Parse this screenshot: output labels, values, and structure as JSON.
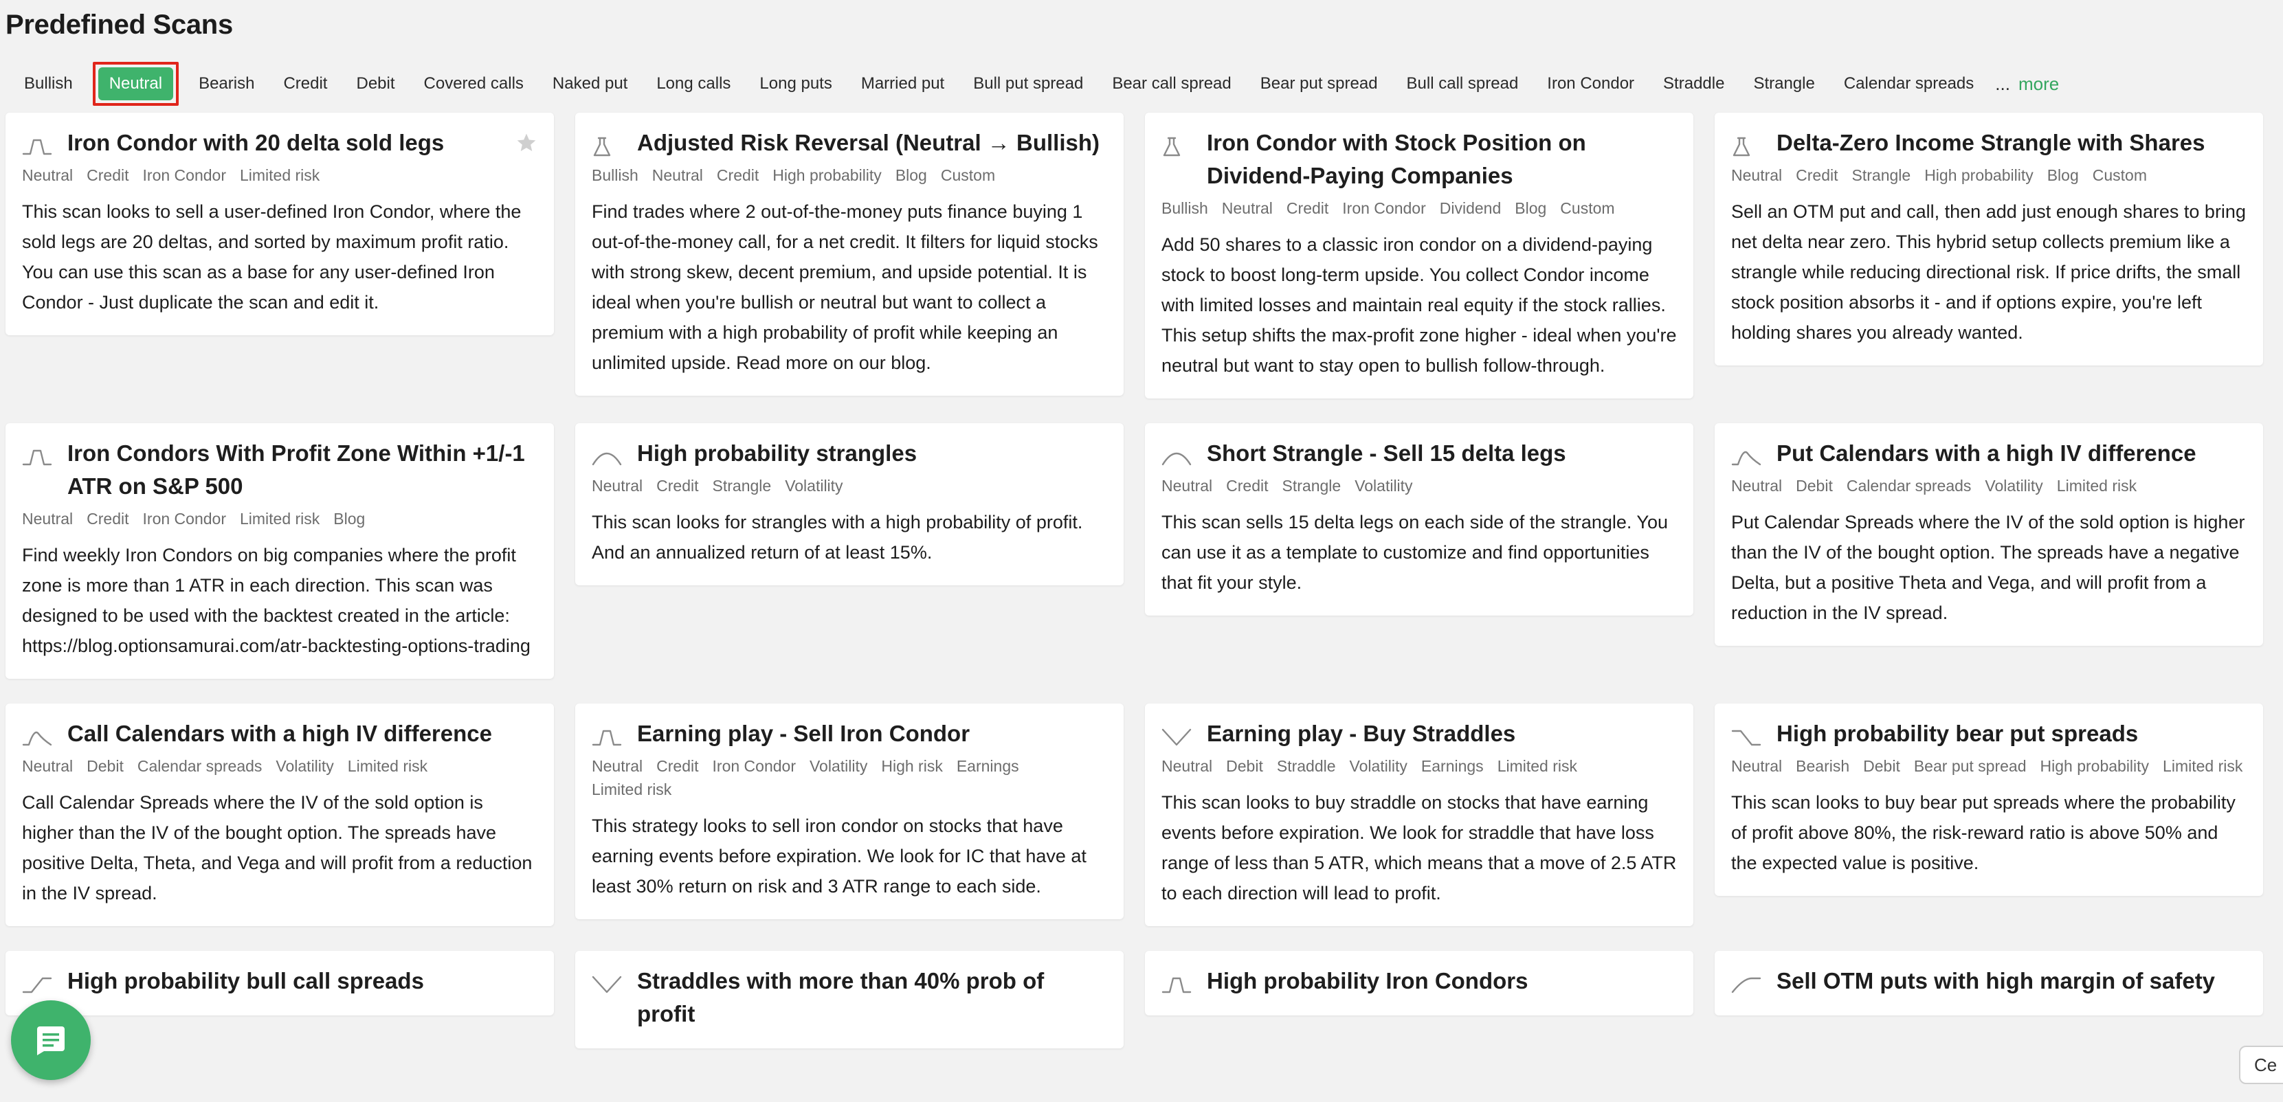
{
  "page": {
    "title": "Predefined Scans"
  },
  "filters": {
    "chips": [
      {
        "label": "Bullish"
      },
      {
        "label": "Neutral",
        "active": true
      },
      {
        "label": "Bearish"
      },
      {
        "label": "Credit"
      },
      {
        "label": "Debit"
      },
      {
        "label": "Covered calls"
      },
      {
        "label": "Naked put"
      },
      {
        "label": "Long calls"
      },
      {
        "label": "Long puts"
      },
      {
        "label": "Married put"
      },
      {
        "label": "Bull put spread"
      },
      {
        "label": "Bear call spread"
      },
      {
        "label": "Bear put spread"
      },
      {
        "label": "Bull call spread"
      },
      {
        "label": "Iron Condor"
      },
      {
        "label": "Straddle"
      },
      {
        "label": "Strangle"
      },
      {
        "label": "Calendar spreads"
      }
    ],
    "ellipsis": "...",
    "more_label": "more",
    "active_color": "#3fb36c",
    "highlight_color": "#e0251b"
  },
  "cards": [
    {
      "icon": "iron-condor-icon",
      "title": "Iron Condor with 20 delta sold legs",
      "starred": true,
      "tags": [
        "Neutral",
        "Credit",
        "Iron Condor",
        "Limited risk"
      ],
      "description": "This scan looks to sell a user-defined Iron Condor, where the sold legs are 20 deltas, and sorted by maximum profit ratio. You can use this scan as a base for any user-defined Iron Condor - Just duplicate the scan and edit it."
    },
    {
      "icon": "flask-icon",
      "title": "Adjusted Risk Reversal (Neutral → Bullish)",
      "tags": [
        "Bullish",
        "Neutral",
        "Credit",
        "High probability",
        "Blog",
        "Custom"
      ],
      "description": "Find trades where 2 out-of-the-money puts finance buying 1 out-of-the-money call, for a net credit. It filters for liquid stocks with strong skew, decent premium, and upside potential. It is ideal when you're bullish or neutral but want to collect a premium with a high probability of profit while keeping an unlimited upside. Read more on our blog."
    },
    {
      "icon": "flask-icon",
      "title": "Iron Condor with Stock Position on Dividend-Paying Companies",
      "tags": [
        "Bullish",
        "Neutral",
        "Credit",
        "Iron Condor",
        "Dividend",
        "Blog",
        "Custom"
      ],
      "description": "Add 50 shares to a classic iron condor on a dividend-paying stock to boost long-term upside. You collect Condor income with limited losses and maintain real equity if the stock rallies. This setup shifts the max-profit zone higher - ideal when you're neutral but want to stay open to bullish follow-through."
    },
    {
      "icon": "flask-icon",
      "title": "Delta-Zero Income Strangle with Shares",
      "tags": [
        "Neutral",
        "Credit",
        "Strangle",
        "High probability",
        "Blog",
        "Custom"
      ],
      "description": "Sell an OTM put and call, then add just enough shares to bring net delta near zero. This hybrid setup collects premium like a strangle while reducing directional risk. If price drifts, the small stock position absorbs it - and if options expire, you're left holding shares you already wanted."
    },
    {
      "icon": "iron-condor-icon",
      "title": "Iron Condors With Profit Zone Within +1/-1 ATR on S&P 500",
      "tags": [
        "Neutral",
        "Credit",
        "Iron Condor",
        "Limited risk",
        "Blog"
      ],
      "description": "Find weekly Iron Condors on big companies where the profit zone is more than 1 ATR in each direction. This scan was designed to be used with the backtest created in the article: https://blog.optionsamurai.com/atr-backtesting-options-trading"
    },
    {
      "icon": "strangle-icon",
      "title": "High probability strangles",
      "tags": [
        "Neutral",
        "Credit",
        "Strangle",
        "Volatility"
      ],
      "description": "This scan looks for strangles with a high probability of profit. And an annualized return of at least 15%."
    },
    {
      "icon": "strangle-icon",
      "title": "Short Strangle - Sell 15 delta legs",
      "tags": [
        "Neutral",
        "Credit",
        "Strangle",
        "Volatility"
      ],
      "description": "This scan sells 15 delta legs on each side of the strangle. You can use it as a template to customize and find opportunities that fit your style."
    },
    {
      "icon": "calendar-icon",
      "title": "Put Calendars with a high IV difference",
      "tags": [
        "Neutral",
        "Debit",
        "Calendar spreads",
        "Volatility",
        "Limited risk"
      ],
      "description": "Put Calendar Spreads where the IV of the sold option is higher than the IV of the bought option. The spreads have a negative Delta, but a positive Theta and Vega, and will profit from a reduction in the IV spread."
    },
    {
      "icon": "calendar-icon",
      "title": "Call Calendars with a high IV difference",
      "tags": [
        "Neutral",
        "Debit",
        "Calendar spreads",
        "Volatility",
        "Limited risk"
      ],
      "description": "Call Calendar Spreads where the IV of the sold option is higher than the IV of the bought option. The spreads have positive Delta, Theta, and Vega and will profit from a reduction in the IV spread."
    },
    {
      "icon": "iron-condor-icon",
      "title": "Earning play - Sell Iron Condor",
      "tags": [
        "Neutral",
        "Credit",
        "Iron Condor",
        "Volatility",
        "High risk",
        "Earnings",
        "Limited risk"
      ],
      "description": "This strategy looks to sell iron condor on stocks that have earning events before expiration. We look for IC that have at least 30% return on risk and 3 ATR range to each side."
    },
    {
      "icon": "straddle-icon",
      "title": "Earning play - Buy Straddles",
      "tags": [
        "Neutral",
        "Debit",
        "Straddle",
        "Volatility",
        "Earnings",
        "Limited risk"
      ],
      "description": "This scan looks to buy straddle on stocks that have earning events before expiration. We look for straddle that have loss range of less than 5 ATR, which means that a move of 2.5 ATR to each direction will lead to profit."
    },
    {
      "icon": "bear-put-icon",
      "title": "High probability bear put spreads",
      "tags": [
        "Neutral",
        "Bearish",
        "Debit",
        "Bear put spread",
        "High probability",
        "Limited risk"
      ],
      "description": "This scan looks to buy bear put spreads where the probability of profit above 80%, the risk-reward ratio is above 50% and the expected value is positive."
    },
    {
      "icon": "bull-call-icon",
      "title": "High probability bull call spreads",
      "tags": [],
      "description": ""
    },
    {
      "icon": "straddle-icon",
      "title": "Straddles with more than 40% prob of profit",
      "tags": [],
      "description": ""
    },
    {
      "icon": "iron-condor-icon",
      "title": "High probability Iron Condors",
      "tags": [],
      "description": ""
    },
    {
      "icon": "sell-put-icon",
      "title": "Sell OTM puts with high margin of safety",
      "tags": [],
      "description": ""
    }
  ],
  "chat_button": {
    "icon": "chat-icon",
    "color": "#3fb36c"
  },
  "cookie_button": {
    "label": "Ce"
  }
}
